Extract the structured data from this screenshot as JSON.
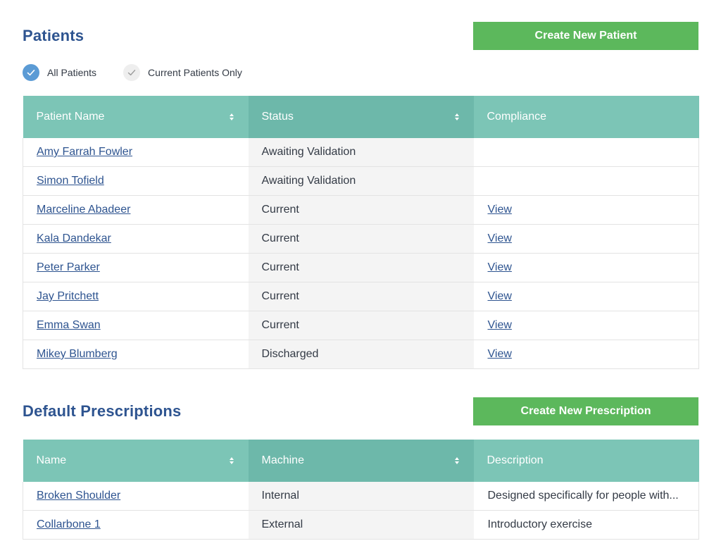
{
  "patients": {
    "title": "Patients",
    "create_button": "Create New Patient",
    "filters": [
      {
        "label": "All Patients",
        "checked": true
      },
      {
        "label": "Current Patients Only",
        "checked": false
      }
    ],
    "columns": [
      "Patient Name",
      "Status",
      "Compliance"
    ],
    "rows": [
      {
        "name": "Amy Farrah Fowler",
        "status": "Awaiting Validation",
        "compliance": ""
      },
      {
        "name": "Simon Tofield",
        "status": "Awaiting Validation",
        "compliance": ""
      },
      {
        "name": "Marceline Abadeer",
        "status": "Current",
        "compliance": "View"
      },
      {
        "name": "Kala Dandekar",
        "status": "Current",
        "compliance": "View"
      },
      {
        "name": "Peter Parker",
        "status": "Current",
        "compliance": "View"
      },
      {
        "name": "Jay Pritchett",
        "status": "Current",
        "compliance": "View"
      },
      {
        "name": "Emma Swan",
        "status": "Current",
        "compliance": "View"
      },
      {
        "name": "Mikey Blumberg",
        "status": "Discharged",
        "compliance": "View"
      }
    ]
  },
  "prescriptions": {
    "title": "Default Prescriptions",
    "create_button": "Create New Prescription",
    "columns": [
      "Name",
      "Machine",
      "Description"
    ],
    "rows": [
      {
        "name": "Broken Shoulder",
        "machine": "Internal",
        "description": "Designed specifically for people with..."
      },
      {
        "name": "Collarbone 1",
        "machine": "External",
        "description": "Introductory exercise"
      }
    ]
  },
  "colors": {
    "accent_green": "#5cb85c",
    "header_teal": "#7cc5b6",
    "title_blue": "#2e5490",
    "check_blue": "#5b9bd5"
  },
  "icons": {
    "sort": "sort-arrows-icon",
    "check": "checkmark-icon"
  }
}
